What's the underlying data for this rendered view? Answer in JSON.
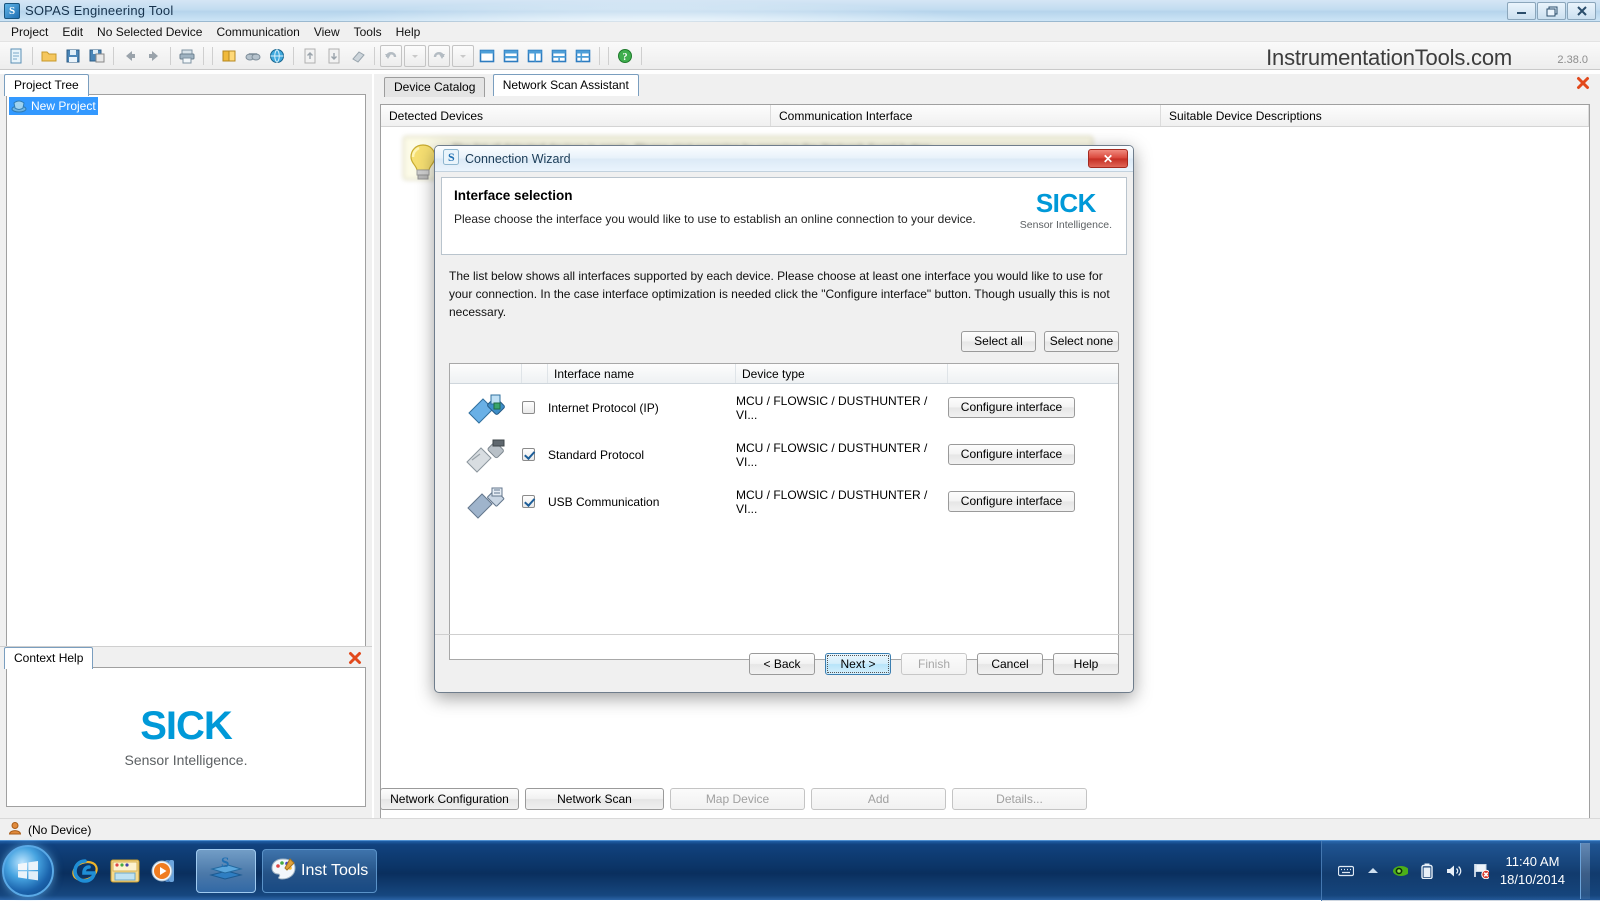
{
  "window": {
    "title": "SOPAS Engineering Tool",
    "app_icon": "sopas-s-icon",
    "minimize": "minimize-icon",
    "maximize": "restore-icon",
    "close": "close-icon"
  },
  "menu": {
    "items": [
      "Project",
      "Edit",
      "No Selected Device",
      "Communication",
      "View",
      "Tools",
      "Help"
    ]
  },
  "toolbar": {
    "brand": "InstrumentationTools.com",
    "version": "2.38.0",
    "buttons": [
      "new-document-icon",
      "open-folder-icon",
      "save-icon",
      "save-all-icon",
      "back-arrow-icon",
      "forward-arrow-icon",
      "print-icon",
      "device-catalog-icon",
      "scan-icon",
      "network-globe-icon",
      "upload-document-icon",
      "download-document-icon",
      "erase-icon",
      "undo-icon",
      "undo-dropdown-icon",
      "redo-icon",
      "redo-dropdown-icon",
      "layout-single-icon",
      "layout-horizontal-icon",
      "layout-vertical-icon",
      "layout-three-icon",
      "layout-four-icon",
      "help-circle-icon"
    ]
  },
  "left_panel": {
    "tab": "Project Tree",
    "tree": [
      {
        "label": "New Project",
        "icon": "project-icon",
        "selected": true
      }
    ]
  },
  "context_help": {
    "tab": "Context Help",
    "close": "close-icon",
    "logo_text": "SICK",
    "logo_sub": "Sensor Intelligence."
  },
  "right_panel": {
    "tabs": [
      {
        "label": "Device Catalog",
        "active": false
      },
      {
        "label": "Network Scan Assistant",
        "active": true
      }
    ],
    "close": "close-icon",
    "columns": [
      "Detected Devices",
      "Communication Interface",
      "Suitable Device Descriptions"
    ],
    "rows": [],
    "bottom_buttons": [
      {
        "label": "Network Configuration",
        "enabled": true
      },
      {
        "label": "Network Scan",
        "enabled": true
      },
      {
        "label": "Map Device",
        "enabled": false
      },
      {
        "label": "Add",
        "enabled": false
      },
      {
        "label": "Details...",
        "enabled": false
      }
    ]
  },
  "hint_balloon": {
    "icon": "lightbulb-icon",
    "text": "The list of detected devices is empty. Please start scanning by pressing the \"Network Scan\" button."
  },
  "dialog": {
    "title": "Connection Wizard",
    "icon": "sopas-s-icon",
    "close": "close-icon",
    "heading": "Interface selection",
    "subheading": "Please choose the interface you would like to use to establish an online connection to your device.",
    "logo_text": "SICK",
    "logo_sub": "Sensor Intelligence.",
    "description": "The list below shows all interfaces supported by each device. Please choose at least one interface you would like to use for your connection. In the case interface optimization is needed click the \"Configure interface\" button. Though usually this is not necessary.",
    "select_all": "Select all",
    "select_none": "Select none",
    "table": {
      "columns": [
        "",
        "",
        "Interface name",
        "Device type",
        ""
      ],
      "rows": [
        {
          "icon": "ethernet-plug-icon",
          "checked": false,
          "name": "Internet Protocol (IP)",
          "device_type": "MCU / FLOWSIC / DUSTHUNTER / VI...",
          "button": "Configure interface"
        },
        {
          "icon": "serial-plug-icon",
          "checked": true,
          "name": "Standard Protocol",
          "device_type": "MCU / FLOWSIC / DUSTHUNTER / VI...",
          "button": "Configure interface"
        },
        {
          "icon": "usb-plug-icon",
          "checked": true,
          "name": "USB Communication",
          "device_type": "MCU / FLOWSIC / DUSTHUNTER / VI...",
          "button": "Configure interface"
        }
      ]
    },
    "footer_buttons": [
      {
        "label": "< Back",
        "state": "normal"
      },
      {
        "label": "Next >",
        "state": "default"
      },
      {
        "label": "Finish",
        "state": "disabled"
      },
      {
        "label": "Cancel",
        "state": "normal"
      },
      {
        "label": "Help",
        "state": "normal"
      }
    ]
  },
  "statusbar": {
    "icon": "user-icon",
    "text": "(No Device)"
  },
  "taskbar": {
    "start": "windows-orb-icon",
    "quicklaunch": [
      "internet-explorer-icon",
      "windows-explorer-icon",
      "media-player-icon"
    ],
    "tasks": [
      {
        "label": "",
        "icon": "sopas-taskbar-icon",
        "active": true
      },
      {
        "label": "Inst Tools",
        "icon": "paint-icon",
        "active": false
      }
    ],
    "tray": [
      "keyboard-icon",
      "show-hidden-icons-arrow",
      "nvidia-icon",
      "battery-icon",
      "volume-icon",
      "action-center-flag-icon"
    ],
    "time": "11:40 AM",
    "date": "18/10/2014"
  },
  "colors": {
    "sick_blue": "#0099d8",
    "selection_blue": "#3399ff",
    "taskbar_blue": "#0b3466",
    "close_red": "#c52f24"
  }
}
